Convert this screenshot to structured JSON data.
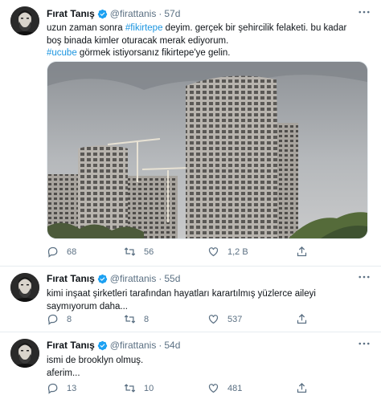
{
  "tweets": [
    {
      "author": "Fırat Tanış",
      "handle": "@firattanis",
      "time": "57d",
      "lines": [
        [
          {
            "t": "uzun zaman sonra ",
            "tag": false
          },
          {
            "t": "#fikirtepe",
            "tag": true
          },
          {
            "t": " deyim. gerçek bir şehircilik felaketi. bu kadar",
            "tag": false
          }
        ],
        [
          {
            "t": "boş binada kimler oturacak merak ediyorum.",
            "tag": false
          }
        ],
        [
          {
            "t": "#ucube",
            "tag": true
          },
          {
            "t": " görmek istiyorsanız fikirtepe'ye gelin.",
            "tag": false
          }
        ]
      ],
      "replies": "68",
      "retweets": "56",
      "likes": "1,2 B"
    },
    {
      "author": "Fırat Tanış",
      "handle": "@firattanis",
      "time": "55d",
      "lines": [
        [
          {
            "t": "kimi inşaat şirketleri tarafından hayatları karartılmış yüzlerce aileyi",
            "tag": false
          }
        ],
        [
          {
            "t": "saymıyorum daha...",
            "tag": false
          }
        ]
      ],
      "replies": "8",
      "retweets": "8",
      "likes": "537"
    },
    {
      "author": "Fırat Tanış",
      "handle": "@firattanis",
      "time": "54d",
      "lines": [
        [
          {
            "t": "ismi de brooklyn olmuş.",
            "tag": false
          }
        ],
        [
          {
            "t": "aferim...",
            "tag": false
          }
        ]
      ],
      "replies": "13",
      "retweets": "10",
      "likes": "481"
    }
  ],
  "icons": {
    "verified": "verified-badge-icon",
    "more": "more-options-icon",
    "reply": "reply-icon",
    "retweet": "retweet-icon",
    "like": "like-icon",
    "share": "share-icon"
  },
  "colors": {
    "accent": "#1da1f2",
    "hashtag": "#1b95e0",
    "muted": "#5b7083",
    "text": "#0f1419"
  }
}
